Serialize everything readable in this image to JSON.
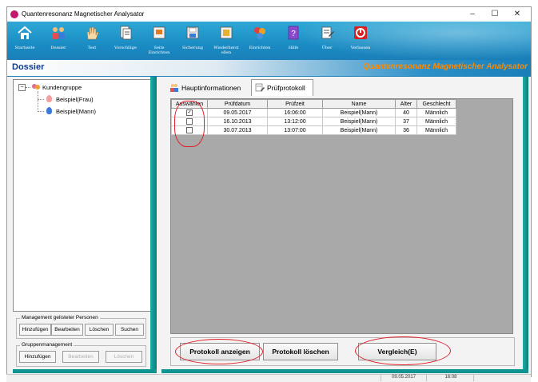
{
  "window": {
    "title": "Quantenresonanz Magnetischer Analysator",
    "controls": [
      "–",
      "☐",
      "✕"
    ]
  },
  "toolbar": {
    "items": [
      {
        "label": "Startseite",
        "icon": "home-icon"
      },
      {
        "label": "Dossier",
        "icon": "people-icon"
      },
      {
        "label": "Test",
        "icon": "hand-icon"
      },
      {
        "label": "Vorschläge",
        "icon": "document-icon"
      },
      {
        "label": "Seite\nEinrichten",
        "icon": "page-setup-icon"
      },
      {
        "label": "Sicherung",
        "icon": "backup-icon"
      },
      {
        "label": "Wiederherst\nellen",
        "icon": "restore-icon"
      },
      {
        "label": "Einrichten",
        "icon": "settings-icon"
      },
      {
        "label": "Hilfe",
        "icon": "help-icon"
      },
      {
        "label": "Über",
        "icon": "about-icon"
      },
      {
        "label": "Verlassen",
        "icon": "power-icon"
      }
    ]
  },
  "header": {
    "title": "Dossier",
    "brand": "Quantenresonanz Magnetischer Analysator"
  },
  "tree": {
    "root": "Kundengruppe",
    "children": [
      "Beispiel(Frau)",
      "Beispiel(Mann)"
    ]
  },
  "person_mgmt": {
    "title": "Management gelisteter Personen",
    "buttons": [
      "Hinzufügen",
      "Bearbeiten",
      "Löschen",
      "Suchen"
    ]
  },
  "group_mgmt": {
    "title": "Gruppenmanagement",
    "buttons": [
      "Hinzufügen",
      "Bearbeiten",
      "Löschen"
    ]
  },
  "tabs": [
    {
      "label": "Hauptinformationen",
      "icon": "people-icon"
    },
    {
      "label": "Prüfprotokoll",
      "icon": "protocol-icon"
    }
  ],
  "table": {
    "columns": [
      "Auswählen",
      "Prüfdatum",
      "Prüfzeit",
      "Name",
      "Alter",
      "Geschlecht"
    ],
    "rows": [
      {
        "checked": true,
        "date": "09.05.2017",
        "time": "16:06:00",
        "name": "Beispiel(Mann)",
        "age": "40",
        "gender": "Männlich"
      },
      {
        "checked": false,
        "date": "16.10.2013",
        "time": "13:12:00",
        "name": "Beispiel(Mann)",
        "age": "37",
        "gender": "Männlich"
      },
      {
        "checked": false,
        "date": "30.07.2013",
        "time": "13:07:00",
        "name": "Beispiel(Mann)",
        "age": "36",
        "gender": "Männlich"
      }
    ]
  },
  "actions": {
    "show": "Protokoll anzeigen",
    "delete": "Protokoll löschen",
    "compare": "Vergleich(E)"
  },
  "status": {
    "date": "09.05.2017",
    "time": "16:08"
  },
  "colors": {
    "toolbar": "#1a8cc4",
    "accent_teal": "#0f9490",
    "brand": "#ff8a00",
    "annotation": "#e0202a"
  }
}
